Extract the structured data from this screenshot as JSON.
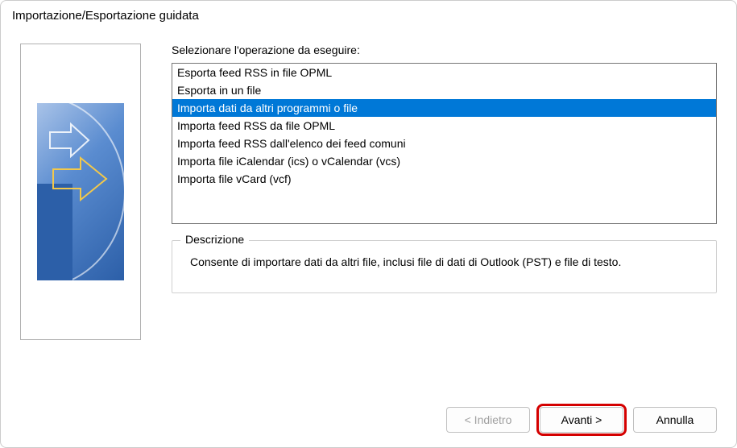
{
  "window": {
    "title": "Importazione/Esportazione guidata"
  },
  "instruction": "Selezionare l'operazione da eseguire:",
  "options": [
    {
      "label": "Esporta feed RSS in file OPML",
      "selected": false
    },
    {
      "label": "Esporta in un file",
      "selected": false
    },
    {
      "label": "Importa dati da altri programmi o file",
      "selected": true
    },
    {
      "label": "Importa feed RSS da file OPML",
      "selected": false
    },
    {
      "label": "Importa feed RSS dall'elenco dei feed comuni",
      "selected": false
    },
    {
      "label": "Importa file iCalendar (ics) o vCalendar (vcs)",
      "selected": false
    },
    {
      "label": "Importa file vCard (vcf)",
      "selected": false
    }
  ],
  "description": {
    "legend": "Descrizione",
    "text": "Consente di importare dati da altri file, inclusi file di dati di Outlook (PST) e file di testo."
  },
  "buttons": {
    "back": "< Indietro",
    "next": "Avanti >",
    "cancel": "Annulla"
  }
}
